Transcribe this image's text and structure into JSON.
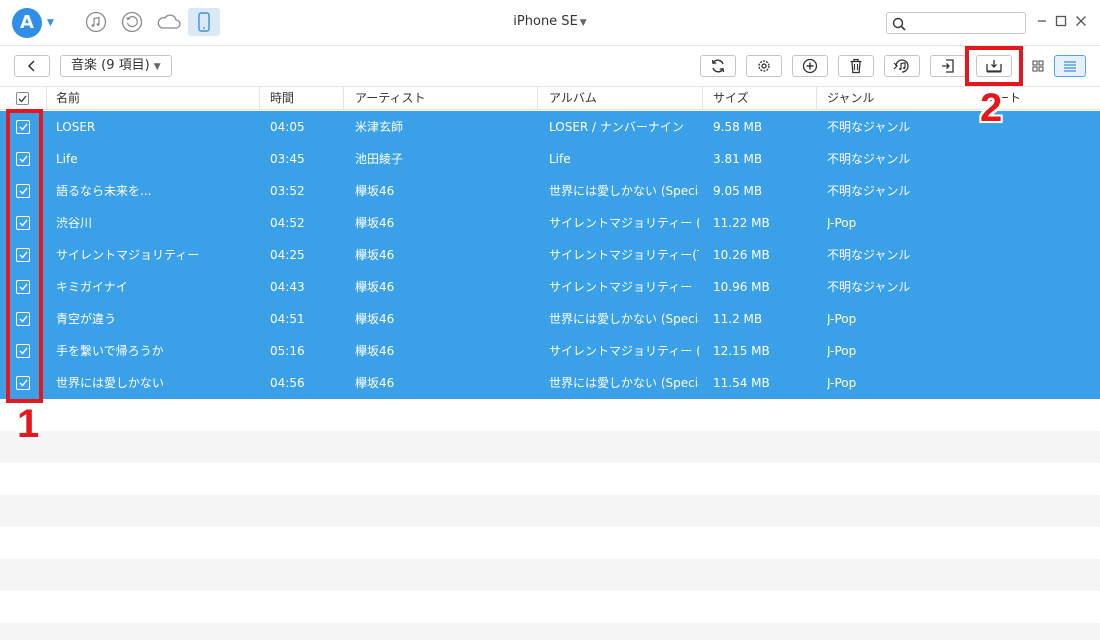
{
  "app": {
    "device_title": "iPhone SE",
    "search": {
      "value": "",
      "placeholder": ""
    }
  },
  "nav_icons": [
    "music-icon",
    "history-icon",
    "cloud-icon",
    "phone-icon"
  ],
  "toolbar": {
    "category_label": "音楽 (9 項目)",
    "tools": [
      "refresh-icon",
      "settings-icon",
      "add-icon",
      "delete-icon",
      "add-to-itunes-icon",
      "export-to-device-icon",
      "export-to-computer-icon"
    ],
    "views": [
      "grid-view-icon",
      "list-view-icon"
    ]
  },
  "table": {
    "columns": {
      "name": "名前",
      "time": "時間",
      "artist": "アーティスト",
      "album": "アルバム",
      "size": "サイズ",
      "genre": "ジャンル",
      "rating": "レート"
    },
    "rows": [
      {
        "name": "LOSER",
        "time": "04:05",
        "artist": "米津玄師",
        "album": "LOSER / ナンバーナイン",
        "size": "9.58 MB",
        "genre": "不明なジャンル",
        "checked": true
      },
      {
        "name": "Life",
        "time": "03:45",
        "artist": "池田綾子",
        "album": "Life",
        "size": "3.81 MB",
        "genre": "不明なジャンル",
        "checked": true
      },
      {
        "name": "語るなら未来を...",
        "time": "03:52",
        "artist": "欅坂46",
        "album": "世界には愛しかない (Specia...",
        "size": "9.05 MB",
        "genre": "不明なジャンル",
        "checked": true
      },
      {
        "name": "渋谷川",
        "time": "04:52",
        "artist": "欅坂46",
        "album": "サイレントマジョリティー (Spec...",
        "size": "11.22 MB",
        "genre": "J-Pop",
        "checked": true
      },
      {
        "name": "サイレントマジョリティー",
        "time": "04:25",
        "artist": "欅坂46",
        "album": "サイレントマジョリティー(TYPE...",
        "size": "10.26 MB",
        "genre": "不明なジャンル",
        "checked": true
      },
      {
        "name": "キミガイナイ",
        "time": "04:43",
        "artist": "欅坂46",
        "album": "サイレントマジョリティー",
        "size": "10.96 MB",
        "genre": "不明なジャンル",
        "checked": true
      },
      {
        "name": "青空が違う",
        "time": "04:51",
        "artist": "欅坂46",
        "album": "世界には愛しかない (Specia...",
        "size": "11.2 MB",
        "genre": "J-Pop",
        "checked": true
      },
      {
        "name": "手を繋いで帰ろうか",
        "time": "05:16",
        "artist": "欅坂46",
        "album": "サイレントマジョリティー (Spec...",
        "size": "12.15 MB",
        "genre": "J-Pop",
        "checked": true
      },
      {
        "name": "世界には愛しかない",
        "time": "04:56",
        "artist": "欅坂46",
        "album": "世界には愛しかない (Specia...",
        "size": "11.54 MB",
        "genre": "J-Pop",
        "checked": true
      }
    ]
  },
  "annotations": [
    {
      "label": "1",
      "target": "row-checkboxes"
    },
    {
      "label": "2",
      "target": "export-to-computer-button"
    }
  ],
  "colors": {
    "accent": "#2f8fe6",
    "selected_row": "#3aa0e8",
    "annotation": "#e5161d"
  }
}
